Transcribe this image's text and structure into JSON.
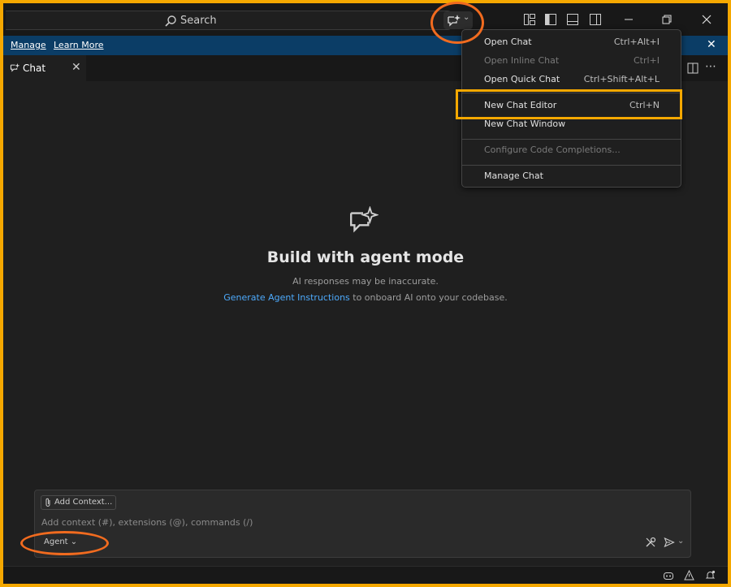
{
  "titlebar": {
    "search_label": "Search"
  },
  "notice": {
    "manage_link": "Manage",
    "learn_more_link": "Learn More"
  },
  "tabs": [
    {
      "label": "Chat"
    }
  ],
  "welcome": {
    "title": "Build with agent mode",
    "subtitle": "AI responses may be inaccurate.",
    "instructions_link": "Generate Agent Instructions",
    "instructions_rest": " to onboard AI onto your codebase."
  },
  "chat_input": {
    "add_context_label": "Add Context...",
    "placeholder": "Add context (#), extensions (@), commands (/)",
    "mode_label": "Agent"
  },
  "menu": {
    "items": [
      {
        "label": "Open Chat",
        "shortcut": "Ctrl+Alt+I",
        "enabled": true
      },
      {
        "label": "Open Inline Chat",
        "shortcut": "Ctrl+I",
        "enabled": false
      },
      {
        "label": "Open Quick Chat",
        "shortcut": "Ctrl+Shift+Alt+L",
        "enabled": true
      },
      {
        "label": "New Chat Editor",
        "shortcut": "Ctrl+N",
        "enabled": true
      },
      {
        "label": "New Chat Window",
        "shortcut": "",
        "enabled": true
      },
      {
        "label": "Configure Code Completions...",
        "shortcut": "",
        "enabled": false
      },
      {
        "label": "Manage Chat",
        "shortcut": "",
        "enabled": true
      }
    ]
  },
  "colors": {
    "frame_border": "#f5a800",
    "annotation_orange": "#f16b1f",
    "notice_bg": "#0b3d66",
    "link_blue": "#4daafc"
  },
  "icons": {
    "copilot": "copilot-chat-sparkle-icon",
    "search": "search-icon",
    "send": "send-icon",
    "tools": "tools-icon"
  }
}
